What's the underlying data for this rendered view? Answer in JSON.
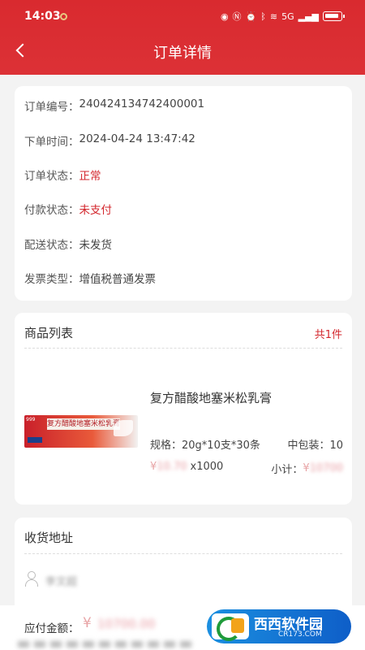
{
  "status": {
    "time": "14:03",
    "net": "5G"
  },
  "nav": {
    "title": "订单详情"
  },
  "order": {
    "rows": [
      {
        "label": "订单编号：",
        "value": "240424134742400001",
        "red": false
      },
      {
        "label": "下单时间：",
        "value": "2024-04-24 13:47:42",
        "red": false
      },
      {
        "label": "订单状态：",
        "value": "正常",
        "red": true
      },
      {
        "label": "付款状态：",
        "value": "未支付",
        "red": true
      },
      {
        "label": "配送状态：",
        "value": "未发货",
        "red": false
      },
      {
        "label": "发票类型：",
        "value": "增值税普通发票",
        "red": false
      }
    ]
  },
  "products": {
    "title": "商品列表",
    "count": "共1件",
    "item": {
      "name": "复方醋酸地塞米松乳膏",
      "image_text": "复方醋酸地塞米松乳膏",
      "spec": "规格：20g*10支*30条",
      "pack": "中包装：10",
      "currency": "¥",
      "price": "10.70",
      "qty": "x1000",
      "subtotal_label": "小计：",
      "subtotal": "10700"
    }
  },
  "address": {
    "title": "收货地址",
    "name": "李文超"
  },
  "bottom": {
    "pay_label": "应付金额：",
    "currency": "¥",
    "amount": "10700.00",
    "badge_text": "西西软件园",
    "badge_sub": "CR173.COM"
  },
  "colors": {
    "header": "#d92a2f",
    "accent": "#d3262c"
  }
}
